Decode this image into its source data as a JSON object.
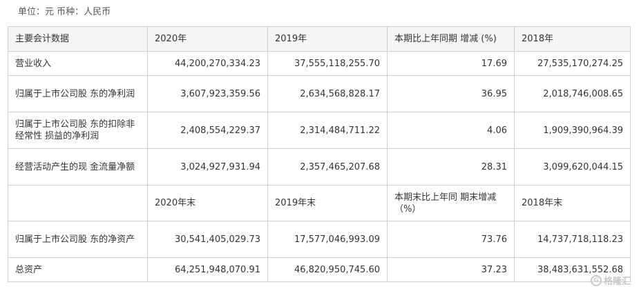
{
  "unit_line": "单位：元 币种：人民币",
  "header1": [
    "主要会计数据",
    "2020年",
    "2019年",
    "本期比上年同期 增减 (%)",
    "2018年"
  ],
  "rows1": [
    {
      "label": "营业收入",
      "v2020": "44,200,270,334.23",
      "v2019": "37,555,118,255.70",
      "change": "17.69",
      "v2018": "27,535,170,274.25"
    },
    {
      "label": "归属于上市公司股 东的净利润",
      "v2020": "3,607,923,359.56",
      "v2019": "2,634,568,828.17",
      "change": "36.95",
      "v2018": "2,018,746,008.65"
    },
    {
      "label": "归属于上市公司股 东的扣除非经常性 损益的净利润",
      "v2020": "2,408,554,229.37",
      "v2019": "2,314,484,711.22",
      "change": "4.06",
      "v2018": "1,909,390,964.39"
    },
    {
      "label": "经营活动产生的现 金流量净额",
      "v2020": "3,024,927,931.94",
      "v2019": "2,357,465,207.68",
      "change": "28.31",
      "v2018": "3,099,620,044.15"
    }
  ],
  "header2": [
    "",
    "2020年末",
    "2019年末",
    "本期末比上年同 期末增减 （%）",
    "2018年末"
  ],
  "rows2": [
    {
      "label": "归属于上市公司股 东的净资产",
      "v2020": "30,541,405,029.73",
      "v2019": "17,577,046,993.09",
      "change": "73.76",
      "v2018": "14,737,718,118.23"
    },
    {
      "label": "总资产",
      "v2020": "64,251,948,070.91",
      "v2019": "46,820,950,745.60",
      "change": "37.23",
      "v2018": "38,483,631,552.68"
    }
  ],
  "watermark": {
    "icon_text": "G",
    "text": "格隆汇"
  }
}
